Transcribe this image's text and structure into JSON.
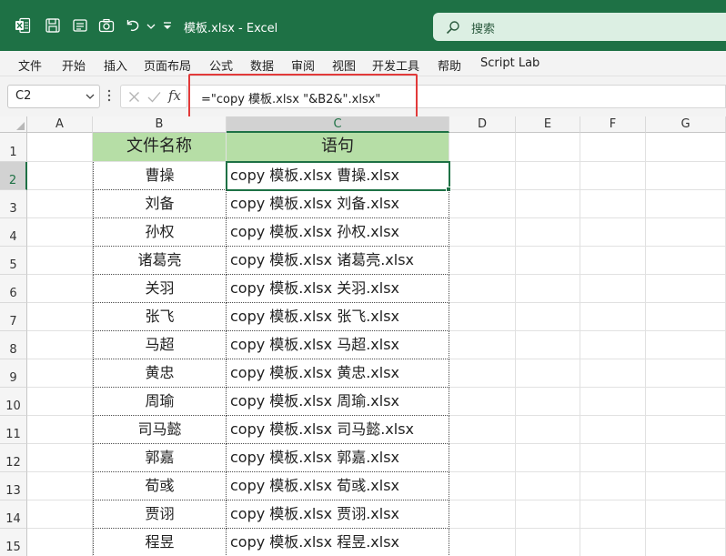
{
  "titlebar": {
    "title": "模板.xlsx  -  Excel",
    "search_placeholder": "搜索",
    "accent": "#1e7145"
  },
  "menu": [
    "文件",
    "开始",
    "插入",
    "页面布局",
    "公式",
    "数据",
    "审阅",
    "视图",
    "开发工具",
    "帮助",
    "Script Lab"
  ],
  "formula_bar": {
    "name_box": "C2",
    "fx": "fx",
    "formula": "=\"copy 模板.xlsx \"&B2&\".xlsx\"",
    "highlight_color": "#e23a3a"
  },
  "sheet": {
    "columns": [
      "A",
      "B",
      "C",
      "D",
      "E",
      "F",
      "G"
    ],
    "active_column": "C",
    "active_row": 2,
    "header_fill": "#b6dea6",
    "headers": {
      "b": "文件名称",
      "c": "语句"
    },
    "rows": [
      {
        "b": "曹操",
        "c": "copy 模板.xlsx 曹操.xlsx"
      },
      {
        "b": "刘备",
        "c": "copy 模板.xlsx 刘备.xlsx"
      },
      {
        "b": "孙权",
        "c": "copy 模板.xlsx 孙权.xlsx"
      },
      {
        "b": "诸葛亮",
        "c": "copy 模板.xlsx 诸葛亮.xlsx"
      },
      {
        "b": "关羽",
        "c": "copy 模板.xlsx 关羽.xlsx"
      },
      {
        "b": "张飞",
        "c": "copy 模板.xlsx 张飞.xlsx"
      },
      {
        "b": "马超",
        "c": "copy 模板.xlsx 马超.xlsx"
      },
      {
        "b": "黄忠",
        "c": "copy 模板.xlsx 黄忠.xlsx"
      },
      {
        "b": "周瑜",
        "c": "copy 模板.xlsx 周瑜.xlsx"
      },
      {
        "b": "司马懿",
        "c": "copy 模板.xlsx 司马懿.xlsx"
      },
      {
        "b": "郭嘉",
        "c": "copy 模板.xlsx 郭嘉.xlsx"
      },
      {
        "b": "荀彧",
        "c": "copy 模板.xlsx 荀彧.xlsx"
      },
      {
        "b": "贾诩",
        "c": "copy 模板.xlsx 贾诩.xlsx"
      },
      {
        "b": "程昱",
        "c": "copy 模板.xlsx 程昱.xlsx"
      }
    ]
  }
}
